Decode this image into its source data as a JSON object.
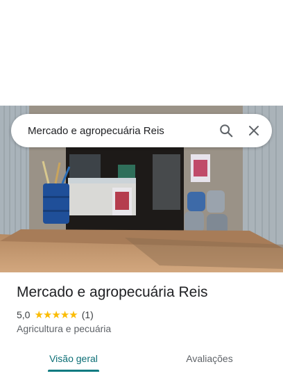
{
  "search": {
    "query": "Mercado e agropecuária Reis",
    "search_icon": "search-icon",
    "close_icon": "close-icon"
  },
  "place": {
    "name": "Mercado e agropecuária Reis",
    "rating": "5,0",
    "stars": 5,
    "review_count": "(1)",
    "category": "Agricultura e pecuária"
  },
  "tabs": [
    {
      "label": "Visão geral",
      "selected": true
    },
    {
      "label": "Avaliações",
      "selected": false
    }
  ],
  "colors": {
    "accent": "#0b7a80",
    "star": "#fbbc04"
  }
}
